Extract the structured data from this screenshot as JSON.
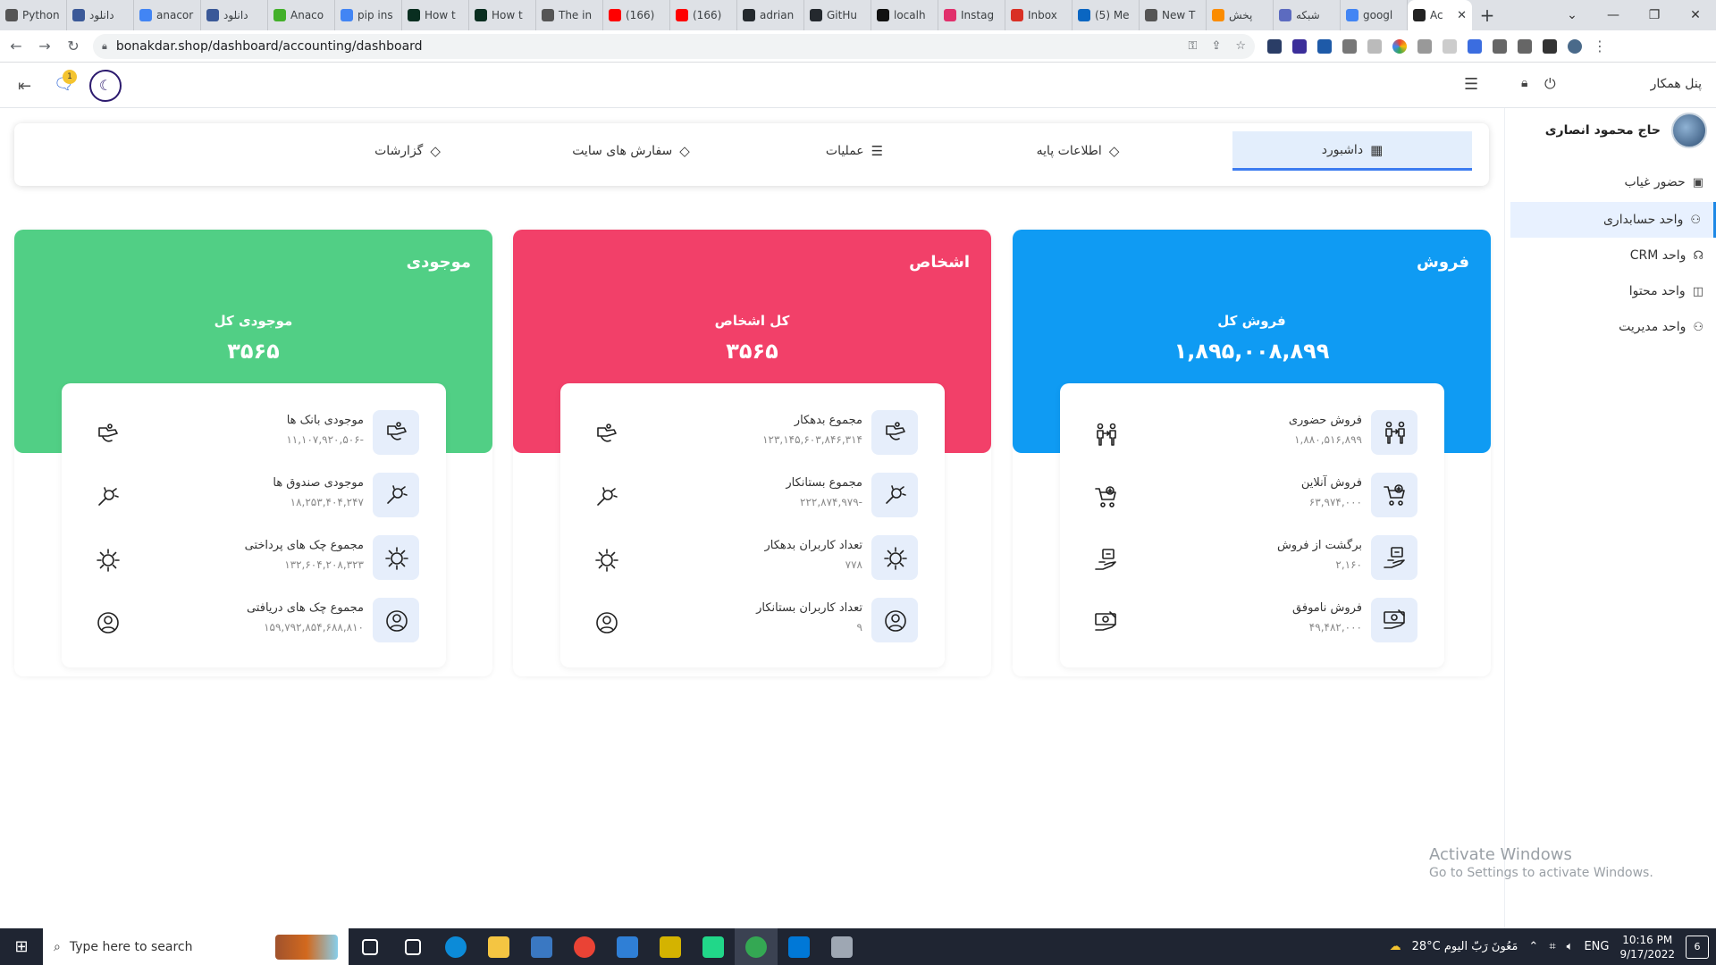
{
  "browser": {
    "tabs": [
      {
        "title": "Python",
        "color": "#555555"
      },
      {
        "title": "دانلود",
        "color": "#3b5998"
      },
      {
        "title": "anacor",
        "color": "#4285f4"
      },
      {
        "title": "دانلود",
        "color": "#3b5998"
      },
      {
        "title": "Anaco",
        "color": "#43b02a"
      },
      {
        "title": "pip ins",
        "color": "#4285f4"
      },
      {
        "title": "How t",
        "color": "#092e20"
      },
      {
        "title": "How t",
        "color": "#092e20"
      },
      {
        "title": "The in",
        "color": "#555555"
      },
      {
        "title": "(166)",
        "color": "#ff0000"
      },
      {
        "title": "(166)",
        "color": "#ff0000"
      },
      {
        "title": "adrian",
        "color": "#24292e"
      },
      {
        "title": "GitHu",
        "color": "#24292e"
      },
      {
        "title": "localh",
        "color": "#111111"
      },
      {
        "title": "Instag",
        "color": "#e1306c"
      },
      {
        "title": "Inbox",
        "color": "#d93025"
      },
      {
        "title": "(5) Me",
        "color": "#0a66c2"
      },
      {
        "title": "New T",
        "color": "#555555"
      },
      {
        "title": "پخش",
        "color": "#fb8c00"
      },
      {
        "title": "شبکه",
        "color": "#5c6bc0"
      },
      {
        "title": "googl",
        "color": "#4285f4"
      },
      {
        "title": "Ac",
        "color": "#222222"
      }
    ],
    "url": "bonakdar.shop/dashboard/accounting/dashboard",
    "new_tab_symbol": "+",
    "window_controls": [
      "⌄",
      "—",
      "❐",
      "✕"
    ]
  },
  "header": {
    "panel_label": "پنل همکار",
    "notification_count": "1"
  },
  "sidebar": {
    "user_name": "حاج محمود انصاری",
    "items": [
      {
        "label": "حضور غیاب",
        "icon": "calendar-icon",
        "glyph": "▣"
      },
      {
        "label": "واحد حسابداری",
        "icon": "users-icon",
        "glyph": "⚇"
      },
      {
        "label": "واحد CRM",
        "icon": "headset-icon",
        "glyph": "☊"
      },
      {
        "label": "واحد محتوا",
        "icon": "book-icon",
        "glyph": "◫"
      },
      {
        "label": "واحد مدیریت",
        "icon": "users-icon",
        "glyph": "⚇"
      }
    ]
  },
  "topnav": {
    "tabs": [
      {
        "label": "داشبورد",
        "glyph": "▦"
      },
      {
        "label": "اطلاعات پایه",
        "glyph": "◇"
      },
      {
        "label": "عملیات",
        "glyph": "☰"
      },
      {
        "label": "سفارش های سایت",
        "glyph": "◇"
      },
      {
        "label": "گزارشات",
        "glyph": "◇"
      }
    ]
  },
  "cards": {
    "sales": {
      "title": "فروش",
      "subtitle": "فروش کل",
      "total": "۱,۸۹۵,۰۰۸,۸۹۹",
      "color": "#0f9bf3",
      "rows": [
        {
          "label": "فروش حضوری",
          "value": "۱,۸۸۰,۵۱۶,۸۹۹"
        },
        {
          "label": "فروش آنلاین",
          "value": "۶۳,۹۷۴,۰۰۰"
        },
        {
          "label": "برگشت از فروش",
          "value": "۲,۱۶۰"
        },
        {
          "label": "فروش ناموفق",
          "value": "۴۹,۴۸۲,۰۰۰"
        }
      ]
    },
    "persons": {
      "title": "اشخاص",
      "subtitle": "کل اشخاص",
      "total": "۳۵۶۵",
      "color": "#f24069",
      "rows": [
        {
          "label": "مجموع بدهکار",
          "value": "۱۲۳,۱۴۵,۶۰۳,۸۴۶,۳۱۴"
        },
        {
          "label": "مجموع بستانکار",
          "value": "-۲۲۲,۸۷۴,۹۷۹"
        },
        {
          "label": "تعداد کاربران بدهکار",
          "value": "۷۷۸"
        },
        {
          "label": "تعداد کاربران بستانکار",
          "value": "۹"
        }
      ]
    },
    "inventory": {
      "title": "موجودی",
      "subtitle": "موجودی کل",
      "total": "۳۵۶۵",
      "color": "#51cf85",
      "rows": [
        {
          "label": "موجودی بانک ها",
          "value": "-۱۱,۱۰۷,۹۲۰,۵۰۶"
        },
        {
          "label": "موجودی صندوق ها",
          "value": "۱۸,۲۵۳,۴۰۴,۲۴۷"
        },
        {
          "label": "مجموع چک های پرداختی",
          "value": "۱۳۲,۶۰۴,۲۰۸,۳۲۳"
        },
        {
          "label": "مجموع چک های دریافتی",
          "value": "۱۵۹,۷۹۲,۸۵۴,۶۸۸,۸۱۰"
        }
      ]
    }
  },
  "watermark": {
    "line1": "Activate Windows",
    "line2": "Go to Settings to activate Windows."
  },
  "taskbar": {
    "search_placeholder": "Type here to search",
    "weather": "28°C  مَعُونَ رَبّ الیوم",
    "lang": "ENG",
    "time": "10:16 PM",
    "date": "9/17/2022",
    "notif_count": "6",
    "apps": [
      {
        "name": "task-view",
        "color": "#ffffff"
      },
      {
        "name": "widgets",
        "color": "#ffffff"
      },
      {
        "name": "edge",
        "color": "#0c8bd8"
      },
      {
        "name": "explorer",
        "color": "#f4c542"
      },
      {
        "name": "store",
        "color": "#3a78c2"
      },
      {
        "name": "chrome",
        "color": "#ea4335"
      },
      {
        "name": "mail",
        "color": "#2f7fd6"
      },
      {
        "name": "app-yellow",
        "color": "#d4b300"
      },
      {
        "name": "pycharm",
        "color": "#21d789"
      },
      {
        "name": "chrome-active",
        "color": "#34a853"
      },
      {
        "name": "vscode",
        "color": "#0078d7"
      },
      {
        "name": "paint",
        "color": "#9ea7b3"
      }
    ]
  }
}
